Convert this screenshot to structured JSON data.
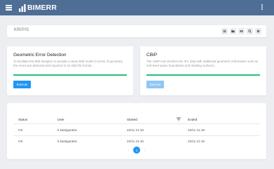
{
  "app": {
    "brand": "BIMERR"
  },
  "page": {
    "title": "KRIPIS"
  },
  "toolbar": {
    "icons": [
      "list-icon",
      "folder-icon",
      "eye-icon",
      "search-icon",
      "gear-icon"
    ]
  },
  "tools": [
    {
      "title": "Geometric Error Detection",
      "description": "To facilitate the BIM designer to provide a clean BIM model in terms of geometry, the errors are detected and reported in an OBJ file format",
      "button_label": "Execute",
      "button_enabled": true
    },
    {
      "title": "CBIP",
      "description": "The CBIP tool enriches the IFC data with additional geometric information such as 2nd-level space boundaries and shading surfaces.",
      "button_label": "Execute",
      "button_enabled": false
    }
  ],
  "table": {
    "headers": {
      "status": "Status",
      "user": "User",
      "started": "Started",
      "ended": "Ended"
    },
    "rows": [
      {
        "status": "OK",
        "user": "k.katsigarakis",
        "started": "22/11 21:18",
        "ended": "22/11 21:18"
      },
      {
        "status": "OK",
        "user": "k.katsigarakis",
        "started": "22/11 21:16",
        "ended": "22/11 21:16"
      }
    ]
  },
  "pagination": {
    "prev": "‹",
    "current": "1",
    "next": "›"
  },
  "colors": {
    "topbar": "#4e6e96",
    "accent": "#2196f3",
    "progress": "#21c17a"
  }
}
